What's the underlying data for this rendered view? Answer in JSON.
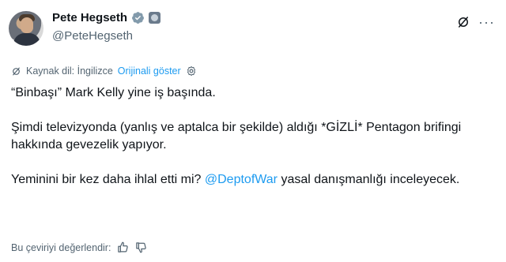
{
  "author": {
    "display_name": "Pete Hegseth",
    "handle": "@PeteHegseth"
  },
  "translation": {
    "source_label": "Kaynak dil: İngilizce",
    "show_original": "Orijinali göster"
  },
  "tweet": {
    "line1": "“Binbaşı” Mark Kelly yine iş başında.",
    "line2": "Şimdi televizyonda (yanlış ve aptalca bir şekilde) aldığı *GİZLİ* Pentagon brifingi hakkında gevezelik yapıyor.",
    "line3_before": "Yeminini bir kez daha ihlal etti mi? ",
    "line3_mention": "@DeptofWar",
    "line3_after": " yasal danışmanlığı inceleyecek."
  },
  "rating": {
    "label": "Bu çeviriyi değerlendir:"
  },
  "colors": {
    "accent": "#1d9bf0",
    "secondary_text": "#536471",
    "primary_text": "#0f1419"
  },
  "icons": [
    "verified-badge-icon",
    "agency-badge-icon",
    "grok-icon",
    "more-icon",
    "translate-icon",
    "settings-icon",
    "thumbs-up-icon",
    "thumbs-down-icon"
  ]
}
